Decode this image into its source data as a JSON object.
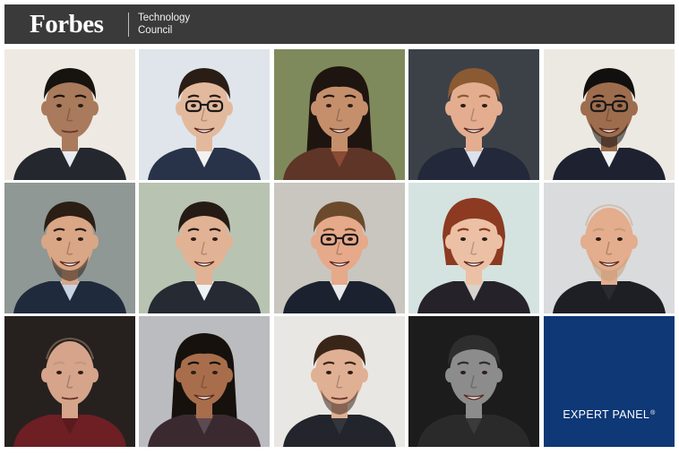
{
  "header": {
    "brand": "Forbes",
    "council_line1": "Technology",
    "council_line2": "Council"
  },
  "panel": {
    "badge_label": "EXPERT PANEL",
    "badge_mark": "®"
  },
  "colors": {
    "header_bg": "#3a3a3a",
    "badge_bg": "#0e3876"
  },
  "members": [
    {
      "bg": "#eeeae3",
      "suit": "#25272e",
      "shirt": "#e8ecf2",
      "skin": "#a97a5b",
      "hair": "#17130f",
      "hairStyle": "short",
      "glasses": false,
      "beard": false,
      "smile": false
    },
    {
      "bg": "#dfe5ea",
      "suit": "#28334a",
      "shirt": "#f2f2f2",
      "skin": "#e3b99d",
      "hair": "#2a1d15",
      "hairStyle": "short",
      "glasses": true,
      "beard": false,
      "smile": true
    },
    {
      "bg": "#7e8a5c",
      "suit": "#5e3526",
      "shirt": "#8a4a33",
      "skin": "#c58f6c",
      "hair": "#1f1510",
      "hairStyle": "long",
      "glasses": false,
      "beard": false,
      "smile": true
    },
    {
      "bg": "#3c4148",
      "suit": "#23293a",
      "shirt": "#dbe2ec",
      "skin": "#e4ad90",
      "hair": "#8b5a33",
      "hairStyle": "short",
      "glasses": false,
      "beard": false,
      "smile": true
    },
    {
      "bg": "#ece9e2",
      "suit": "#1e2230",
      "shirt": "#f4f4f4",
      "skin": "#9e6d4e",
      "hair": "#12100e",
      "hairStyle": "short",
      "glasses": true,
      "beard": true,
      "smile": true
    },
    {
      "bg": "#8f9894",
      "suit": "#1f2a3c",
      "shirt": "#c9d4e3",
      "skin": "#d9a686",
      "hair": "#2b1e15",
      "hairStyle": "short",
      "glasses": false,
      "beard": true,
      "smile": true
    },
    {
      "bg": "#b9c3b2",
      "suit": "#252a33",
      "shirt": "#eef1f4",
      "skin": "#e2b295",
      "hair": "#251b14",
      "hairStyle": "short",
      "glasses": false,
      "beard": false,
      "smile": true
    },
    {
      "bg": "#c8c6bf",
      "suit": "#1c2130",
      "shirt": "#e9e9e9",
      "skin": "#e6a98a",
      "hair": "#6b4a2c",
      "hairStyle": "short",
      "glasses": true,
      "beard": false,
      "smile": true
    },
    {
      "bg": "#d4e3df",
      "suit": "#252329",
      "shirt": "#d8d3cc",
      "skin": "#ecc0a5",
      "hair": "#8c3a22",
      "hairStyle": "bob",
      "glasses": false,
      "beard": false,
      "smile": true
    },
    {
      "bg": "#dadbdc",
      "suit": "#1e1f24",
      "shirt": "#2a2b30",
      "skin": "#e3ad8e",
      "hair": "#c79d7a",
      "hairStyle": "bald",
      "glasses": false,
      "beard": true,
      "smile": true
    },
    {
      "bg": "#26211f",
      "suit": "#6d1f24",
      "shirt": "#5a1a1e",
      "skin": "#d5a48a",
      "hair": "#c4977c",
      "hairStyle": "bald",
      "glasses": false,
      "beard": false,
      "smile": false
    },
    {
      "bg": "#bbbcbf",
      "suit": "#3a2a30",
      "shirt": "#5c4a52",
      "skin": "#a86e4c",
      "hair": "#16110d",
      "hairStyle": "long",
      "glasses": false,
      "beard": false,
      "smile": true
    },
    {
      "bg": "#e9e7e3",
      "suit": "#22252b",
      "shirt": "#33363d",
      "skin": "#e0b094",
      "hair": "#3a2619",
      "hairStyle": "short",
      "glasses": false,
      "beard": true,
      "smile": false
    },
    {
      "bg": "#1c1c1c",
      "suit": "#2a2a2a",
      "shirt": "#3a3a3a",
      "skin": "#8c8c8c",
      "hair": "#2e2e2e",
      "hairStyle": "short",
      "glasses": false,
      "beard": false,
      "smile": true
    }
  ]
}
